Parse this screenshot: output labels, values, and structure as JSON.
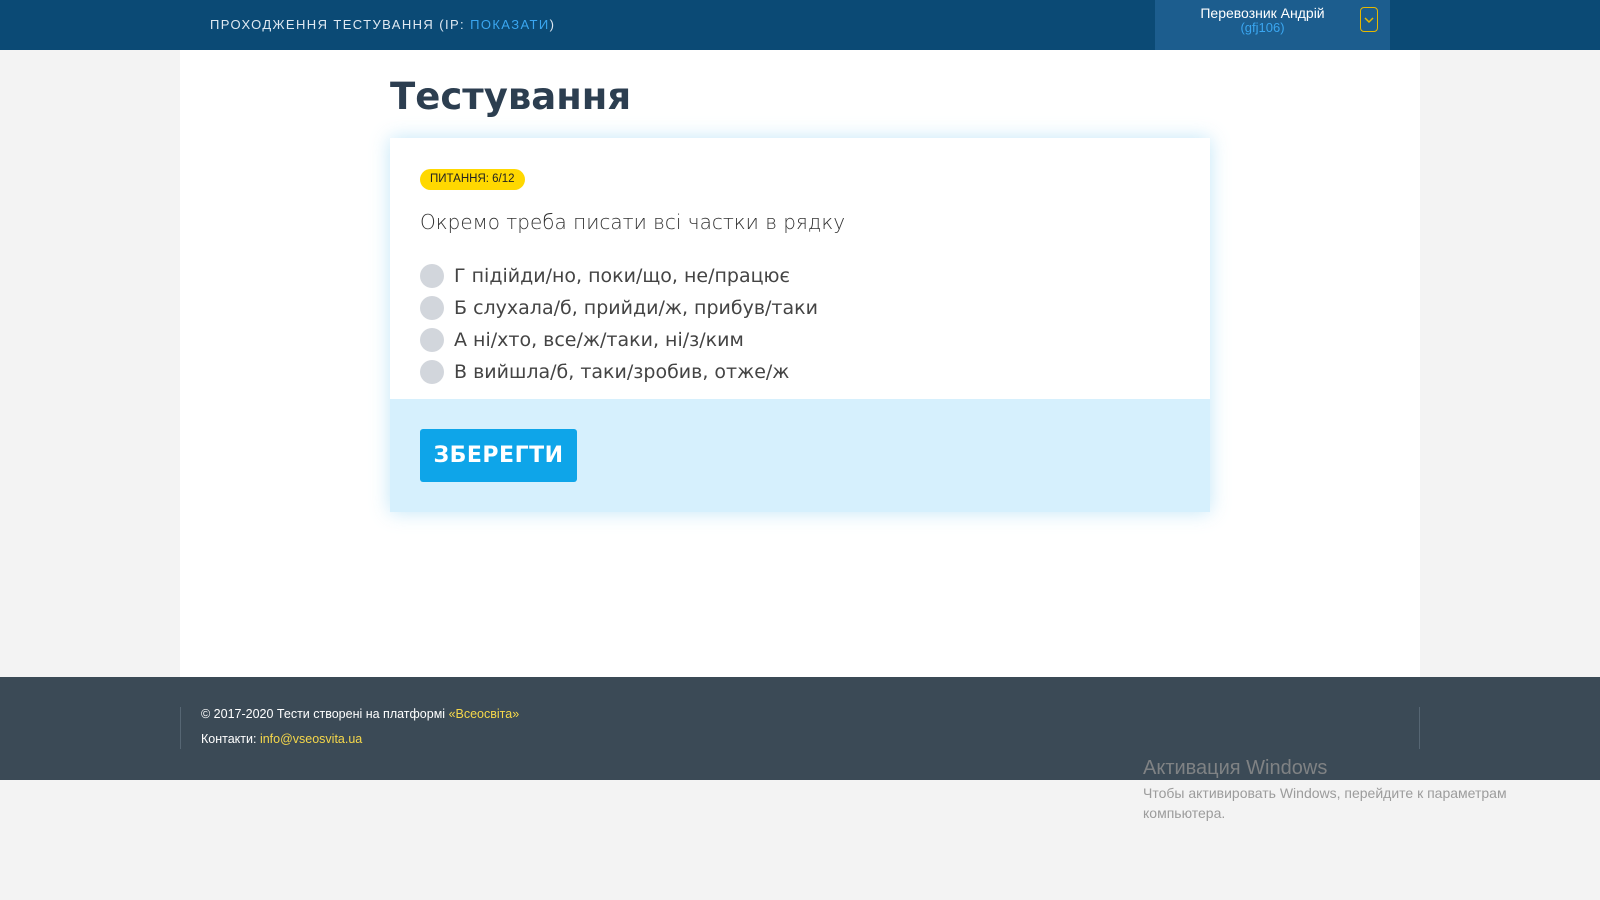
{
  "header": {
    "title_prefix": "ПРОХОДЖЕННЯ ТЕСТУВАННЯ (IP: ",
    "ip_link": "ПОКАЗАТИ",
    "title_suffix": ")",
    "user": {
      "name": "Перевозник Андрій",
      "login": "(gfj106)",
      "toggle_icon": "chevron-down-icon"
    }
  },
  "main": {
    "title": "Тестування",
    "badge": "ПИТАННЯ: 6/12",
    "question": "Окремо треба писати всі частки в рядку",
    "options": [
      {
        "label": "Г підійди/но, поки/що, не/працює",
        "selected": false
      },
      {
        "label": "Б слухала/б, прийди/ж, прибув/таки",
        "selected": false
      },
      {
        "label": "А ні/хто, все/ж/таки, ні/з/ким",
        "selected": false
      },
      {
        "label": "В вийшла/б, таки/зробив, отже/ж",
        "selected": false
      }
    ],
    "save_label": "ЗБЕРЕГТИ"
  },
  "footer": {
    "copyright_prefix": "© 2017-2020 Тести створені на платформі ",
    "platform_link": "«Всеосвіта»",
    "contacts_prefix": "Контакти: ",
    "email": "info@vseosvita.ua"
  },
  "watermark": {
    "title": "Активация Windows",
    "line1": "Чтобы активировать Windows, перейдите к параметрам",
    "line2": "компьютера."
  },
  "colors": {
    "header_bg": "#0b4a75",
    "accent": "#0ea5e9",
    "badge": "#ffd800",
    "footer_bg": "#3b4a56",
    "link": "#3aa6f0",
    "footer_link": "#f5d74a"
  }
}
